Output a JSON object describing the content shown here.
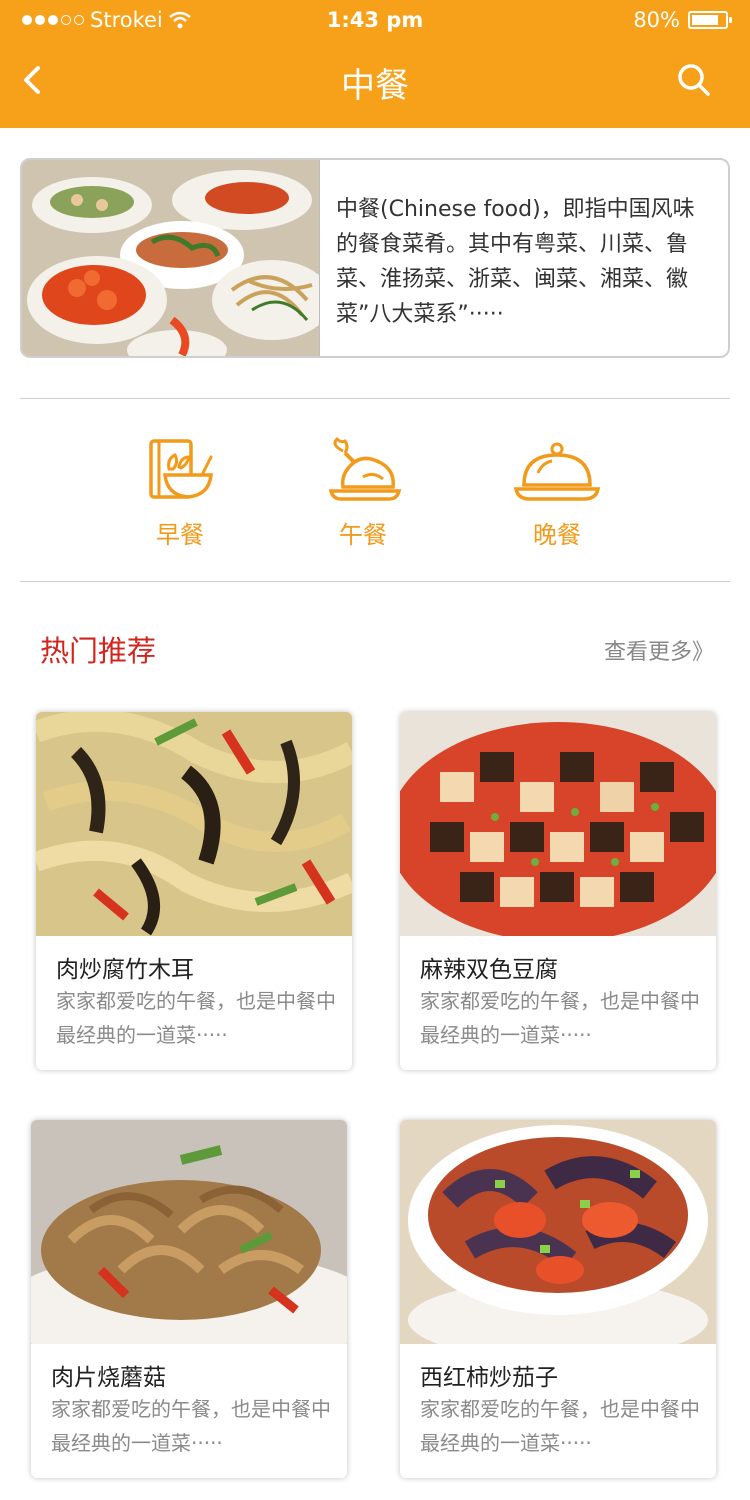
{
  "status_bar": {
    "carrier": "Strokei",
    "time": "1:43 pm",
    "battery": "80%",
    "battery_level": 0.8
  },
  "navbar": {
    "title": "中餐",
    "back_icon": "chevron-left-icon",
    "search_icon": "search-icon",
    "accent_color": "#f7a11a"
  },
  "intro": {
    "image": "chinese-dishes-photo",
    "text": "中餐(Chinese food)，即指中国风味的餐食菜肴。其中有粤菜、川菜、鲁菜、淮扬菜、浙菜、闽菜、湘菜、徽菜”八大菜系”·····"
  },
  "meals": [
    {
      "label": "早餐",
      "icon": "breakfast-bowl-icon"
    },
    {
      "label": "午餐",
      "icon": "roast-chicken-icon"
    },
    {
      "label": "晚餐",
      "icon": "cloche-icon"
    }
  ],
  "section": {
    "title": "热门推荐",
    "more": "查看更多》",
    "title_color": "#d0261f"
  },
  "dishes": [
    {
      "name": "肉炒腐竹木耳",
      "desc": "家家都爱吃的午餐，也是中餐中最经典的一道菜·····",
      "image": "tofu-skin-wood-ear-photo"
    },
    {
      "name": "麻辣双色豆腐",
      "desc": "家家都爱吃的午餐，也是中餐中最经典的一道菜·····",
      "image": "two-color-tofu-photo"
    },
    {
      "name": "肉片烧蘑菇",
      "desc": "家家都爱吃的午餐，也是中餐中最经典的一道菜·····",
      "image": "pork-mushroom-photo"
    },
    {
      "name": "西红柿炒茄子",
      "desc": "家家都爱吃的午餐，也是中餐中最经典的一道菜·····",
      "image": "tomato-eggplant-photo"
    }
  ]
}
